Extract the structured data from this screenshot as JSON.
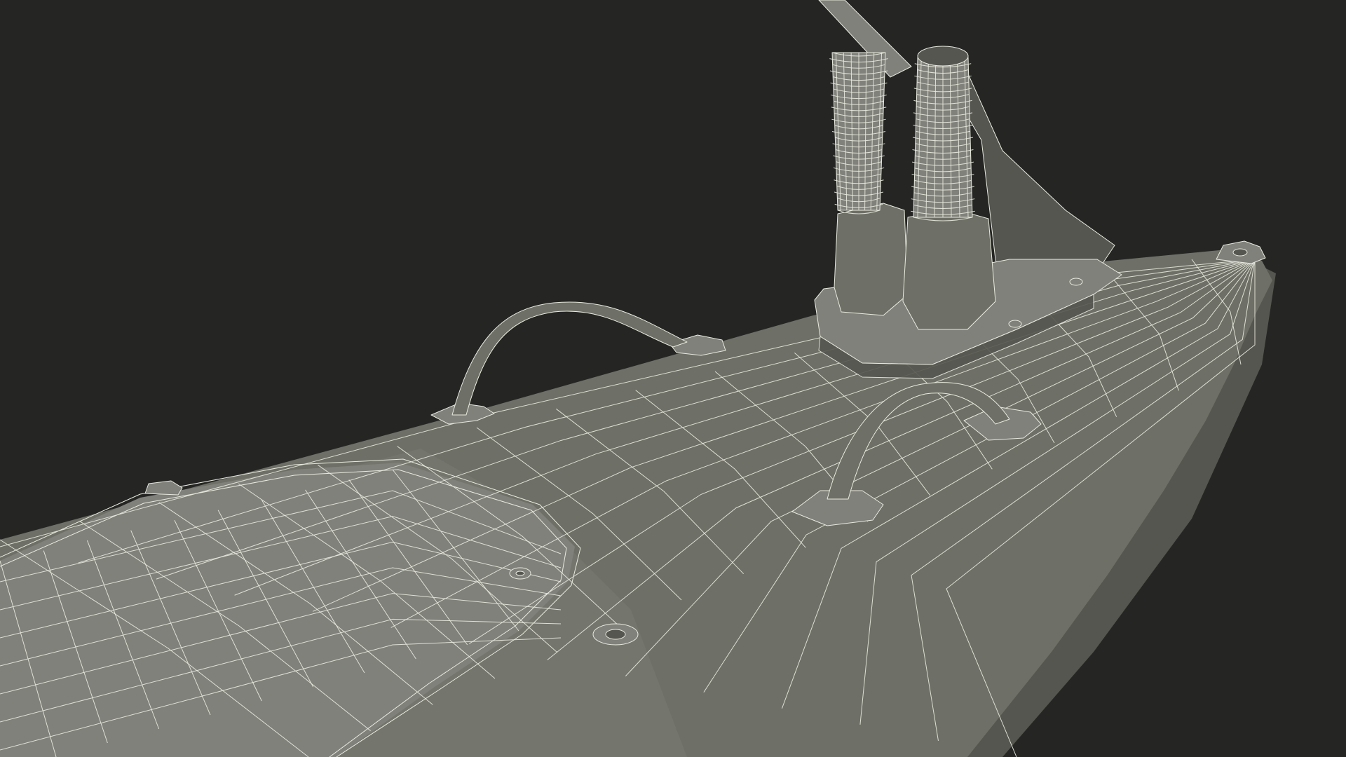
{
  "scene": {
    "background_color": "#252624",
    "surface_color": "#6e6f66",
    "surface_light_color": "#80817a",
    "surface_dark_color": "#55564f",
    "wire_color": "#e9eadf"
  }
}
